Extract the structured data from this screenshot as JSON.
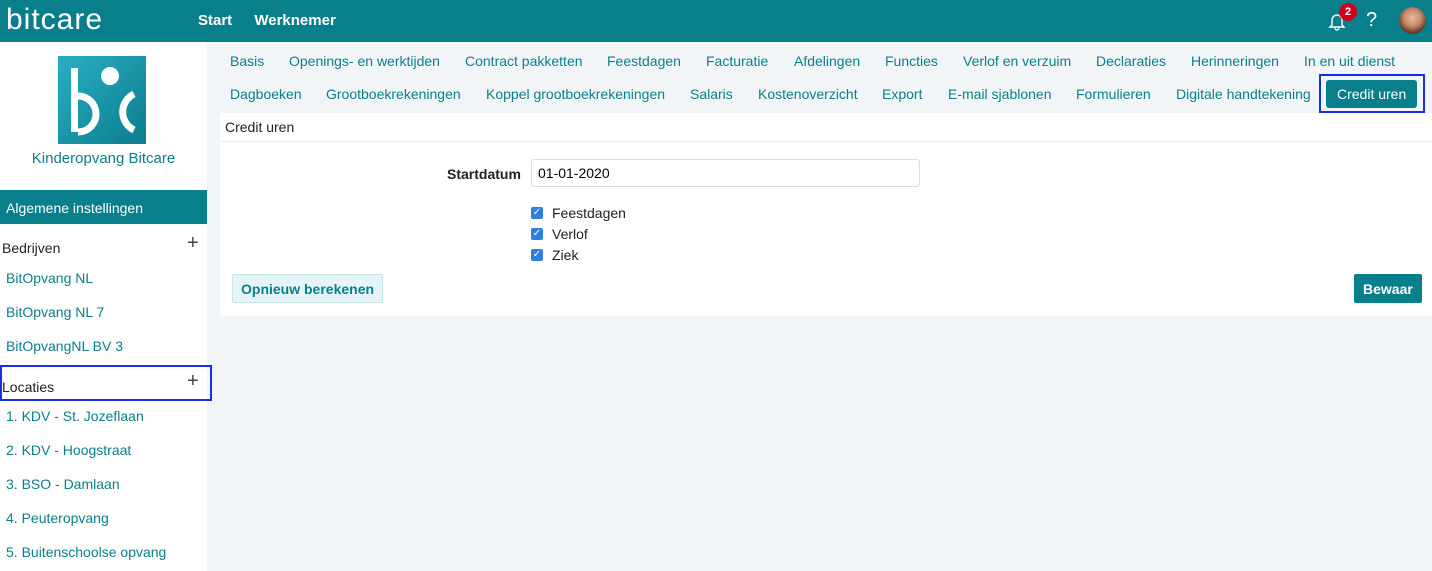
{
  "header": {
    "logo": "bitcare",
    "nav": [
      "Start",
      "Werknemer"
    ],
    "notification_count": "2",
    "help": "?"
  },
  "sidebar": {
    "org_name": "Kinderopvang Bitcare",
    "section": "Algemene instellingen",
    "bedrijven_label": "Bedrijven",
    "bedrijven": [
      "BitOpvang NL",
      "BitOpvang NL 7",
      "BitOpvangNL BV 3"
    ],
    "locaties_label": "Locaties",
    "locaties": [
      "1. KDV - St. Jozeflaan",
      "2. KDV - Hoogstraat",
      "3. BSO - Damlaan",
      "4. Peuteropvang",
      "5. Buitenschoolse opvang"
    ]
  },
  "tabs_row1": [
    "Basis",
    "Openings- en werktijden",
    "Contract pakketten",
    "Feestdagen",
    "Facturatie",
    "Afdelingen",
    "Functies",
    "Verlof en verzuim",
    "Declaraties",
    "Herinneringen",
    "In en uit dienst"
  ],
  "tabs_row2": [
    "Dagboeken",
    "Grootboekrekeningen",
    "Koppel grootboekrekeningen",
    "Salaris",
    "Kostenoverzicht",
    "Export",
    "E-mail sjablonen",
    "Formulieren",
    "Digitale handtekening",
    "Credit uren"
  ],
  "panel": {
    "title": "Credit uren",
    "startdatum_label": "Startdatum",
    "startdatum_value": "01-01-2020",
    "checkboxes": [
      {
        "label": "Feestdagen",
        "checked": true
      },
      {
        "label": "Verlof",
        "checked": true
      },
      {
        "label": "Ziek",
        "checked": true
      }
    ],
    "recalc_button": "Opnieuw berekenen",
    "save_button": "Bewaar"
  }
}
